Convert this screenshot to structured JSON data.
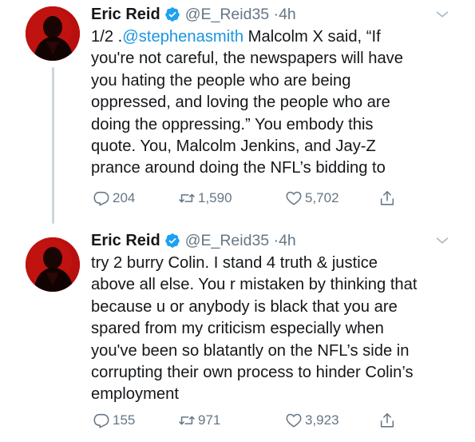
{
  "colors": {
    "name": "#14171a",
    "handle": "#657786",
    "mention": "#1b95e0",
    "verified": "#1da1f2",
    "thread_line": "#ccd6dd",
    "avatar_bg": "#b8100f"
  },
  "tweets": [
    {
      "author_name": "Eric Reid",
      "verified_icon": "verified-badge-icon",
      "handle": "@E_Reid35",
      "separator": "·",
      "time": "4h",
      "text": {
        "prefix": "1/2 .",
        "mention": "@stephenasmith",
        "line1_rest": " Malcolm X said, “If",
        "lines": [
          "you're not careful, the newspapers will have",
          "you hating the people who are being",
          "oppressed, and loving the people who are",
          "doing the oppressing.” You embody this",
          "quote. You, Malcolm Jenkins, and Jay-Z",
          "prance around doing the NFL’s bidding to"
        ]
      },
      "actions": {
        "replies": "204",
        "retweets": "1,590",
        "likes": "5,702"
      }
    },
    {
      "author_name": "Eric Reid",
      "verified_icon": "verified-badge-icon",
      "handle": "@E_Reid35",
      "separator": "·",
      "time": "4h",
      "text": {
        "lines": [
          "try 2 burry Colin. I stand 4 truth & justice",
          "above all else. You r mistaken by thinking that",
          "because u or anybody is black that you are",
          "spared from my criticism especially when",
          "you've been so blatantly on the NFL’s side in",
          "corrupting their own process to hinder Colin’s",
          "employment"
        ]
      },
      "actions": {
        "replies": "155",
        "retweets": "971",
        "likes": "3,923"
      }
    }
  ]
}
